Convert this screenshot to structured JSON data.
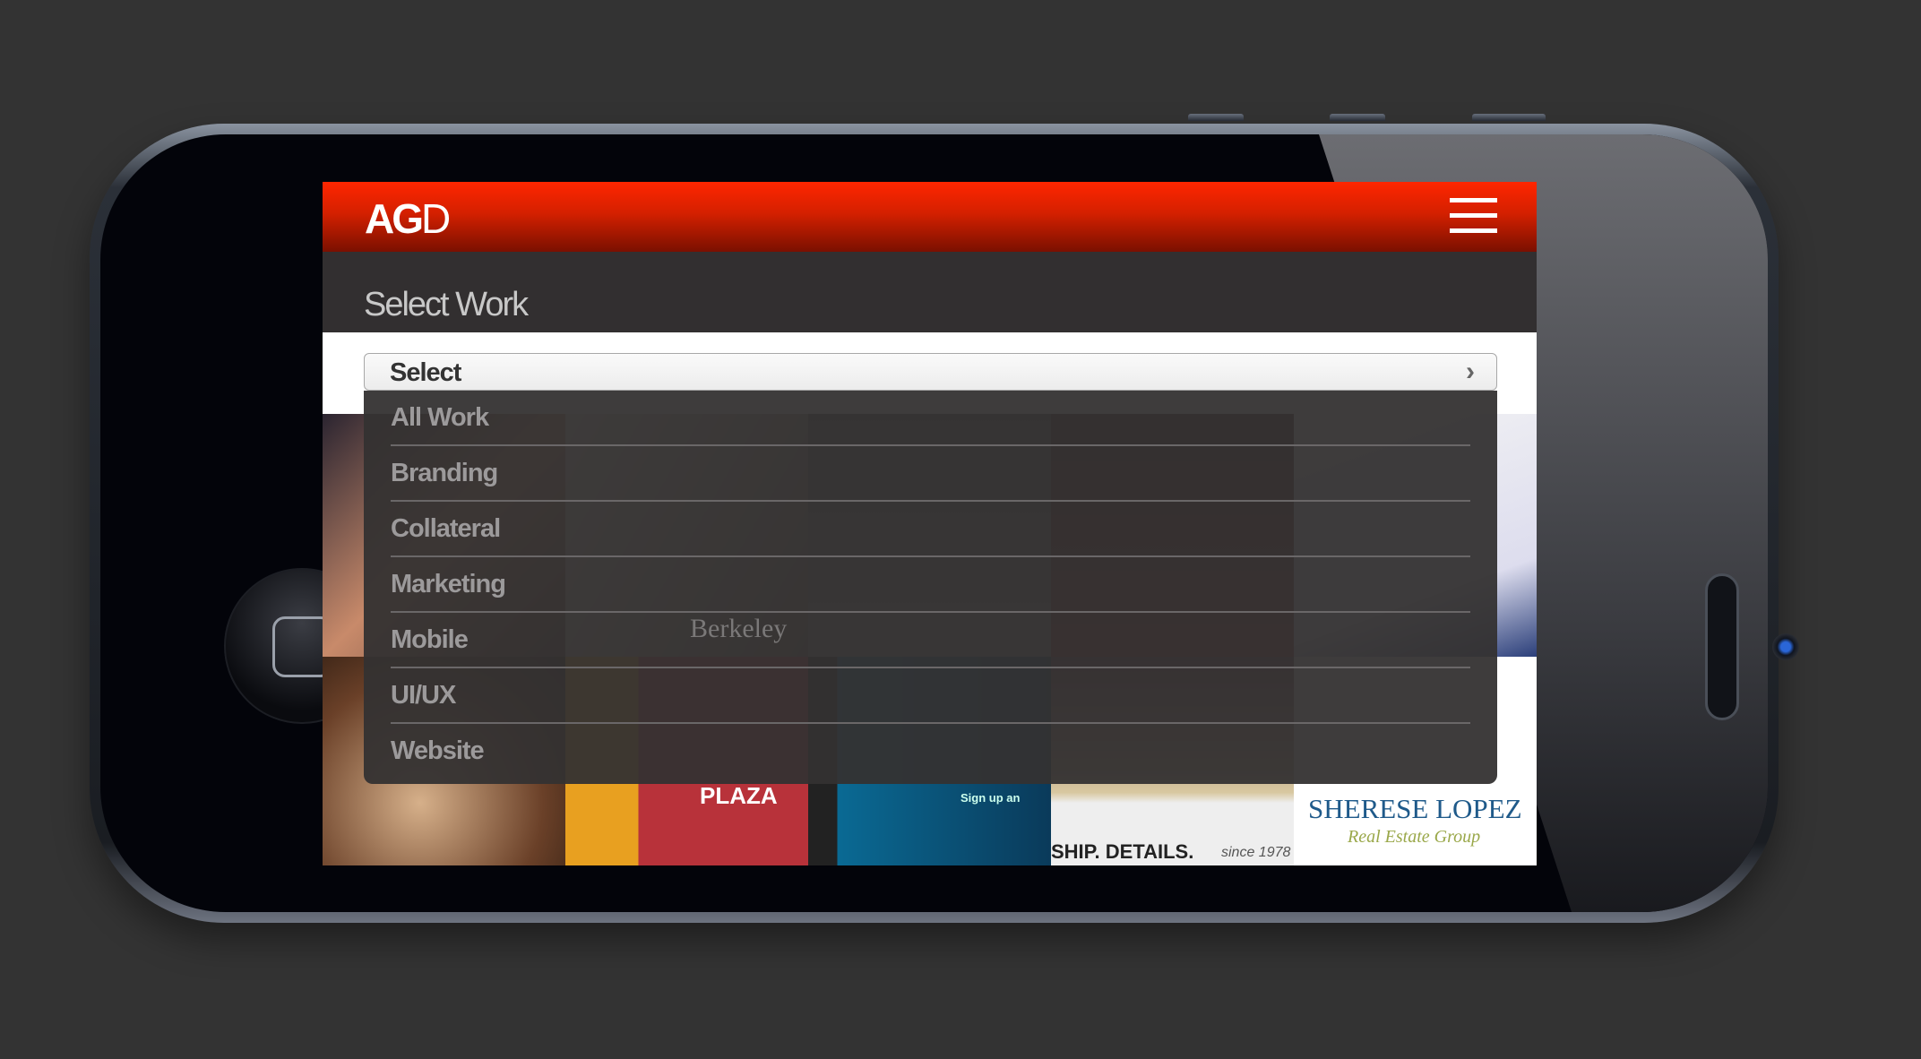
{
  "header": {
    "logo_bold": "AG",
    "logo_light": "D",
    "menu_icon": "hamburger-icon"
  },
  "page_title": "Select Work",
  "select": {
    "label": "Select",
    "icon": "chevron-right-icon"
  },
  "options": [
    "All Work",
    "Branding",
    "Collateral",
    "Marketing",
    "Mobile",
    "UI/UX",
    "Website"
  ],
  "tiles": {
    "berkeley": "Berkeley",
    "plaza": "PLAZA",
    "cloud": "Sign up an",
    "ship": "SHIP. DETAILS.",
    "since": "since 1978",
    "sherese": "SHERESE LOPEZ",
    "sherese_sub": "Real Estate Group"
  },
  "colors": {
    "brand_red": "#ff2600",
    "title_bar": "#322f30"
  }
}
